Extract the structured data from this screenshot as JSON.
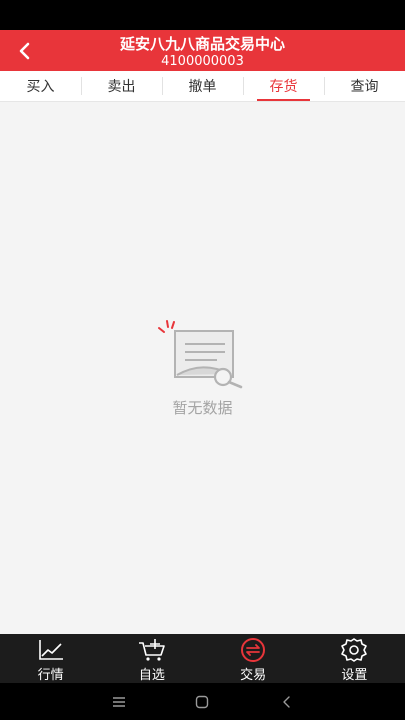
{
  "header": {
    "title": "延安八九八商品交易中心",
    "subtitle": "4100000003"
  },
  "tabs": [
    {
      "label": "买入",
      "active": false
    },
    {
      "label": "卖出",
      "active": false
    },
    {
      "label": "撤单",
      "active": false
    },
    {
      "label": "存货",
      "active": true
    },
    {
      "label": "查询",
      "active": false
    }
  ],
  "empty_state": {
    "icon": "no-data-document-icon",
    "text": "暂无数据"
  },
  "bottom_nav": [
    {
      "label": "行情",
      "icon": "market-chart-icon",
      "active": false
    },
    {
      "label": "自选",
      "icon": "cart-add-icon",
      "active": false
    },
    {
      "label": "交易",
      "icon": "exchange-icon",
      "active": true
    },
    {
      "label": "设置",
      "icon": "gear-icon",
      "active": false
    }
  ],
  "colors": {
    "brand_red": "#e8353a",
    "tabbar_bg": "#1c1c1c",
    "content_bg": "#f4f4f4",
    "empty_text": "#a4a4a4"
  }
}
